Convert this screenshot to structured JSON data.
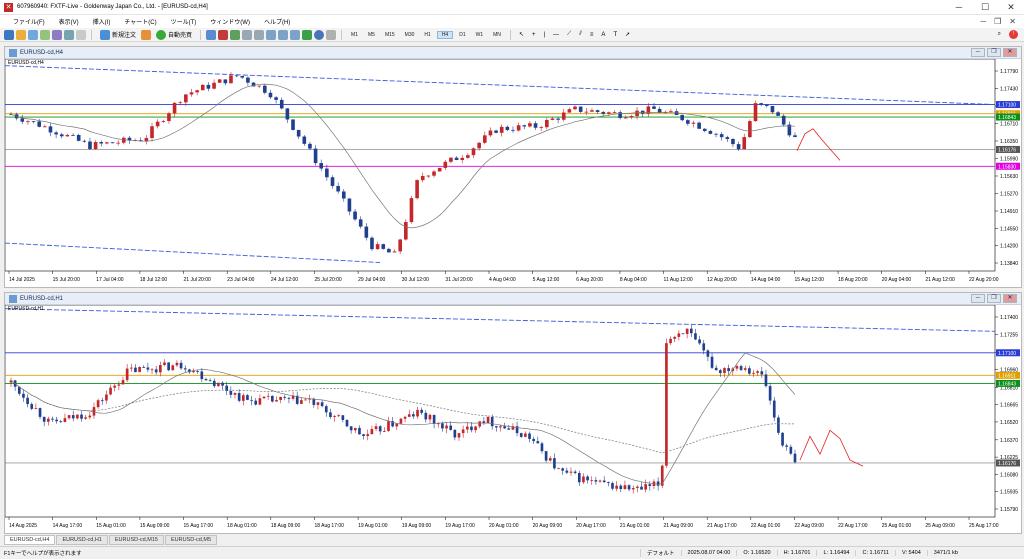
{
  "window": {
    "title": "607960940: FXTF-Live - Goldenway Japan Co., Ltd. - [EURUSD-cd,H4]"
  },
  "menu": [
    "ファイル(F)",
    "表示(V)",
    "挿入(I)",
    "チャート(C)",
    "ツール(T)",
    "ウィンドウ(W)",
    "ヘルプ(H)"
  ],
  "toolbar": {
    "new_order": "新規注文",
    "auto_trade": "自動売買",
    "timeframes": [
      "M1",
      "M5",
      "M15",
      "M30",
      "H1",
      "H4",
      "D1",
      "W1",
      "MN"
    ],
    "active_timeframe": "H4"
  },
  "chart_top": {
    "window_title": "EURUSD-cd,H4",
    "label": "EURUSD-cd,H4",
    "price_ticks": [
      "1.17790",
      "1.17430",
      "1.17070",
      "1.16710",
      "1.16350",
      "1.15990",
      "1.15630",
      "1.15270",
      "1.14910",
      "1.14550",
      "1.14200",
      "1.13840"
    ],
    "price_tags": [
      {
        "value": "1.17100",
        "color": "#2a3cd6"
      },
      {
        "value": "1.16911",
        "color": "#e0a000"
      },
      {
        "value": "1.16843",
        "color": "#0a8f1a"
      },
      {
        "value": "1.16176",
        "color": "#555555"
      },
      {
        "value": "1.15830",
        "color": "#e000e0"
      }
    ],
    "time_labels": [
      "14 Jul 2025",
      "15 Jul 20:00",
      "17 Jul 04:00",
      "18 Jul 12:00",
      "21 Jul 20:00",
      "23 Jul 04:00",
      "24 Jul 12:00",
      "25 Jul 20:00",
      "29 Jul 04:00",
      "30 Jul 12:00",
      "31 Jul 20:00",
      "4 Aug 04:00",
      "5 Aug 12:00",
      "6 Aug 20:00",
      "8 Aug 04:00",
      "11 Aug 12:00",
      "12 Aug 20:00",
      "14 Aug 04:00",
      "15 Aug 12:00",
      "18 Aug 20:00",
      "20 Aug 04:00",
      "21 Aug 12:00",
      "22 Aug 20:00"
    ]
  },
  "chart_bottom": {
    "window_title": "EURUSD-cd,H1",
    "label": "EURUSD-cd,H1",
    "price_ticks": [
      "1.17400",
      "1.17255",
      "1.17100",
      "1.16960",
      "1.16810",
      "1.16665",
      "1.16520",
      "1.16370",
      "1.16225",
      "1.16080",
      "1.15935",
      "1.15790"
    ],
    "price_tags": [
      {
        "value": "1.17100",
        "color": "#2a3cd6"
      },
      {
        "value": "1.16911",
        "color": "#e0a000"
      },
      {
        "value": "1.16843",
        "color": "#0a8f1a"
      },
      {
        "value": "1.16176",
        "color": "#555555"
      }
    ],
    "time_labels": [
      "14 Aug 2025",
      "14 Aug 17:00",
      "15 Aug 01:00",
      "15 Aug 09:00",
      "15 Aug 17:00",
      "18 Aug 01:00",
      "18 Aug 09:00",
      "18 Aug 17:00",
      "19 Aug 01:00",
      "19 Aug 09:00",
      "19 Aug 17:00",
      "20 Aug 01:00",
      "20 Aug 09:00",
      "20 Aug 17:00",
      "21 Aug 01:00",
      "21 Aug 09:00",
      "21 Aug 17:00",
      "22 Aug 01:00",
      "22 Aug 09:00",
      "22 Aug 17:00",
      "25 Aug 01:00",
      "25 Aug 09:00",
      "25 Aug 17:00"
    ]
  },
  "tabs": [
    "EURUSD-cd,H4",
    "EURUSD-cd,H1",
    "EURUSD-cd,M15",
    "EURUSD-cd,M5"
  ],
  "active_tab": "EURUSD-cd,H4",
  "status": {
    "help": "F1キーでヘルプが表示されます",
    "profile": "デフォルト",
    "datetime": "2025.08.07 04:00",
    "open": "O: 1.16520",
    "high": "H: 1.16701",
    "low": "L: 1.16494",
    "close": "C: 1.16711",
    "volume": "V: 5404",
    "traffic": "3471/1 kb"
  },
  "colors": {
    "bull_candle": "#1f3f8f",
    "bear_candle": "#c4262a",
    "ma_line": "#777777",
    "trend_line": "#3a5bd9",
    "forecast": "#e32222"
  }
}
